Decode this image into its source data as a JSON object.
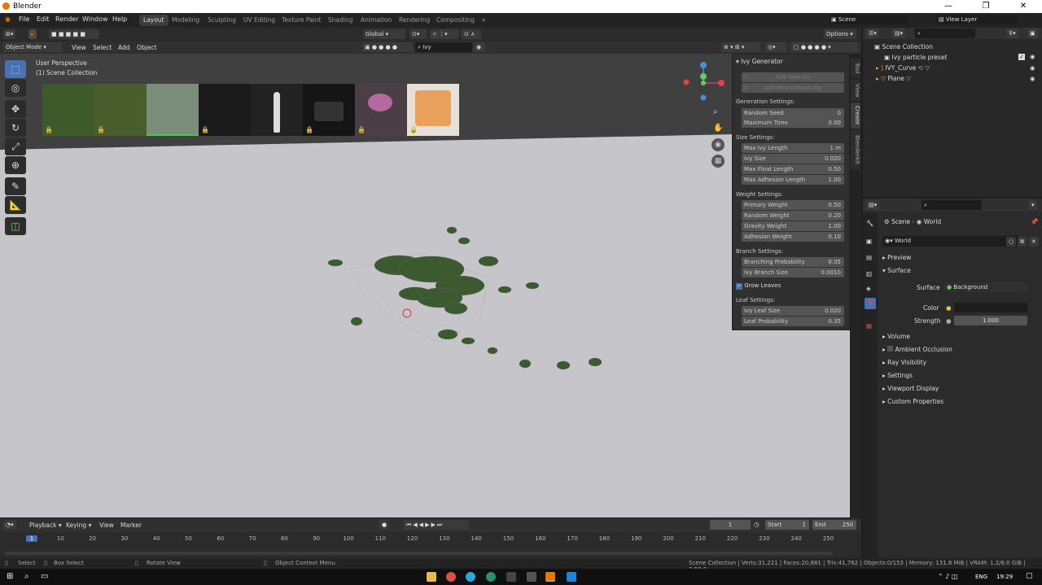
{
  "app": {
    "title": "Blender",
    "min": "—",
    "max": "❐",
    "close": "✕"
  },
  "menus": [
    "File",
    "Edit",
    "Render",
    "Window",
    "Help"
  ],
  "workspaces": [
    "Layout",
    "Modeling",
    "Sculpting",
    "UV Editing",
    "Texture Paint",
    "Shading",
    "Animation",
    "Rendering",
    "Compositing",
    "+"
  ],
  "scene": {
    "label": "Scene",
    "viewlayer": "View Layer"
  },
  "header3d": {
    "transform": "Global",
    "options": "Options",
    "mode": "Object Mode",
    "view": "View",
    "select": "Select",
    "add": "Add",
    "object": "Object",
    "search": "Ivy"
  },
  "viewport": {
    "perspective": "User Perspective",
    "collection": "(1) Scene Collection"
  },
  "thumbs": [
    {
      "color": "#3e5a2a",
      "lock": "🔒"
    },
    {
      "color": "#4a5e2d",
      "lock": "🔒"
    },
    {
      "color": "#7a8c7a",
      "lock": ""
    },
    {
      "color": "#1a1a1a",
      "lock": "🔒"
    },
    {
      "color": "#222",
      "lock": ""
    },
    {
      "color": "#151515",
      "lock": "🔒"
    },
    {
      "color": "#4a3f45",
      "lock": "🔒"
    },
    {
      "color": "#d9a07a",
      "lock": "🔒"
    }
  ],
  "ivy": {
    "title": "Ivy Generator",
    "add_new": "Add New Ivy",
    "add_default": "Add New Default Ivy",
    "gen_header": "Generation Settings:",
    "gen": [
      [
        "Random Seed",
        "0"
      ],
      [
        "Maximum Time",
        "0.00"
      ]
    ],
    "size_header": "Size Settings:",
    "size": [
      [
        "Max Ivy Length",
        "1 m"
      ],
      [
        "Ivy Size",
        "0.020"
      ],
      [
        "Max Float Length",
        "0.50"
      ],
      [
        "Max Adhesion Length",
        "1.00"
      ]
    ],
    "weight_header": "Weight Settings:",
    "weight": [
      [
        "Primary Weight",
        "0.50"
      ],
      [
        "Random Weight",
        "0.20"
      ],
      [
        "Gravity Weight",
        "1.00"
      ],
      [
        "Adhesion Weight",
        "0.10"
      ]
    ],
    "branch_header": "Branch Settings:",
    "branch": [
      [
        "Branching Probability",
        "0.05"
      ],
      [
        "Ivy Branch Size",
        "0.0010"
      ]
    ],
    "grow": "Grow Leaves",
    "leaf_header": "Leaf Settings:",
    "leaf": [
      [
        "Ivy Leaf Size",
        "0.020"
      ],
      [
        "Leaf Probability",
        "0.35"
      ]
    ]
  },
  "sidetabs": [
    "Tool",
    "View",
    "Create",
    "Blenderkit"
  ],
  "outliner": {
    "root": "Scene Collection",
    "items": [
      "Ivy particle preset",
      "IVY_Curve",
      "Plane"
    ]
  },
  "props": {
    "scene": "Scene",
    "world": "World",
    "world_name": "World",
    "sections": [
      "Preview",
      "Surface"
    ],
    "surface_label": "Surface",
    "surface_val": "Background",
    "color_label": "Color",
    "strength_label": "Strength",
    "strength_val": "1.000",
    "more": [
      "Volume",
      "Ambient Occlusion",
      "Ray Visibility",
      "Settings",
      "Viewport Display",
      "Custom Properties"
    ]
  },
  "timeline": {
    "playback": "Playback",
    "keying": "Keying",
    "view": "View",
    "marker": "Marker",
    "frame": "1",
    "start_label": "Start",
    "start": "1",
    "end_label": "End",
    "end": "250",
    "ticks": [
      "1",
      "10",
      "20",
      "30",
      "40",
      "50",
      "60",
      "70",
      "80",
      "90",
      "100",
      "110",
      "120",
      "130",
      "140",
      "150",
      "160",
      "170",
      "180",
      "190",
      "200",
      "210",
      "220",
      "230",
      "240",
      "250"
    ]
  },
  "status": {
    "select": "Select",
    "box": "Box Select",
    "rotate": "Rotate View",
    "context": "Object Context Menu",
    "stats": "Scene Collection | Verts:31,221 | Faces:20,881 | Tris:41,762 | Objects:0/153 | Memory: 131.8 MiB | VRAM: 1.2/6.0 GiB | 2.92.0"
  },
  "taskbar": {
    "lang": "ENG",
    "time": "19:29"
  }
}
